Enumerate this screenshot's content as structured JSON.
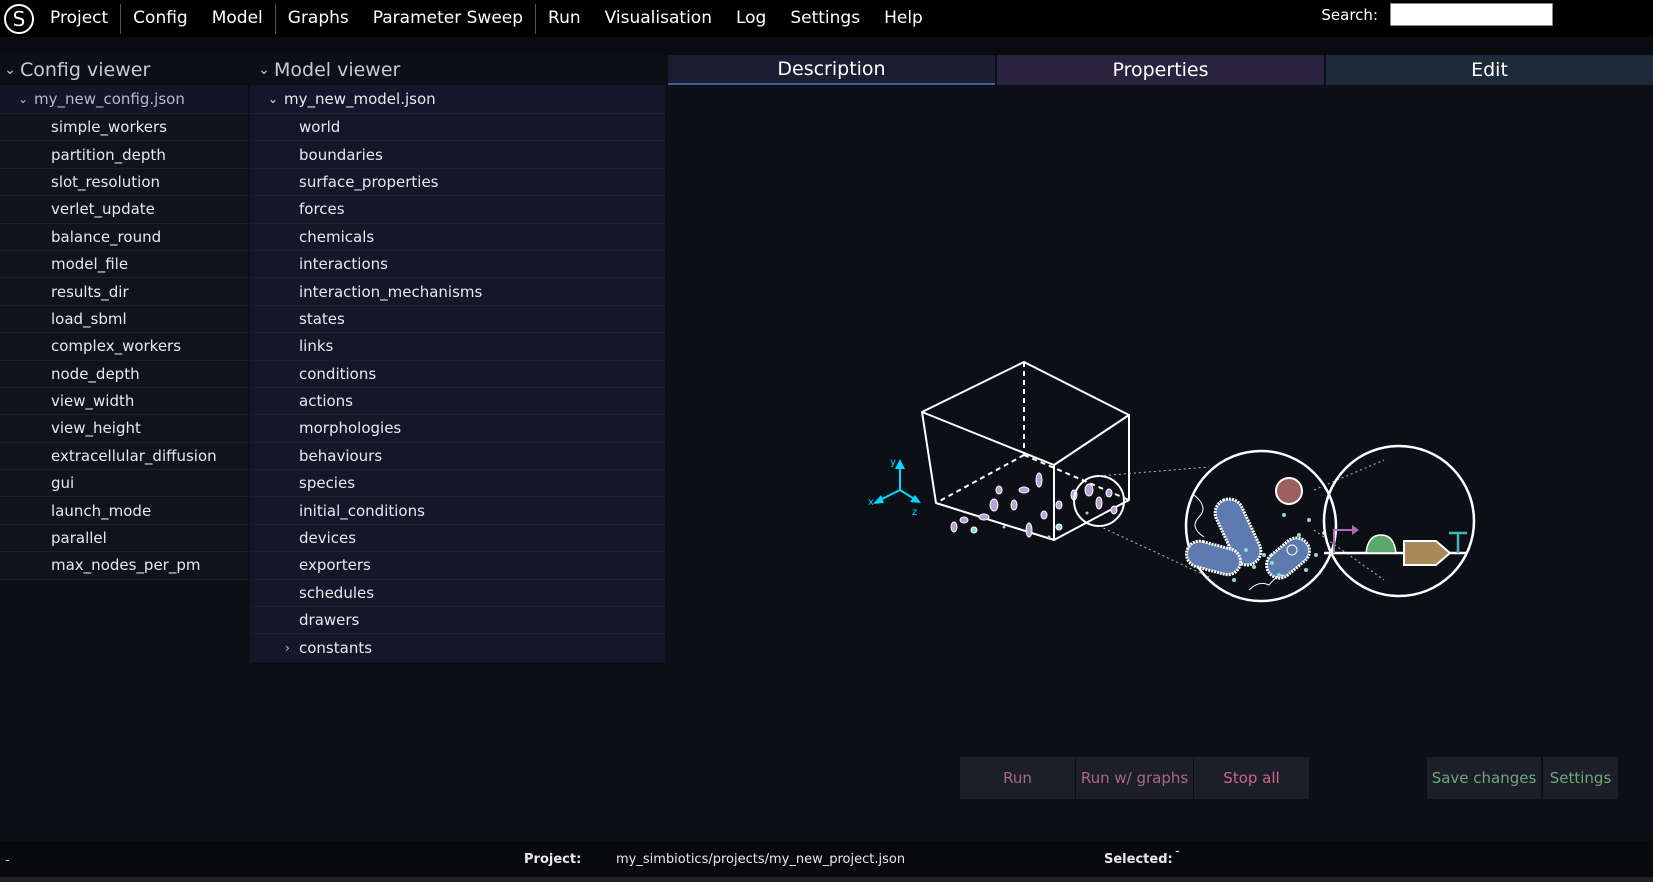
{
  "app": {
    "logo_letter": "S"
  },
  "menu": {
    "items": [
      "Project",
      "Config",
      "Model",
      "Graphs",
      "Parameter Sweep",
      "Run",
      "Visualisation",
      "Log",
      "Settings",
      "Help"
    ]
  },
  "search": {
    "label": "Search:",
    "value": ""
  },
  "config_viewer": {
    "title": "Config viewer",
    "root": "my_new_config.json",
    "items": [
      "simple_workers",
      "partition_depth",
      "slot_resolution",
      "verlet_update",
      "balance_round",
      "model_file",
      "results_dir",
      "load_sbml",
      "complex_workers",
      "node_depth",
      "view_width",
      "view_height",
      "extracellular_diffusion",
      "gui",
      "launch_mode",
      "parallel",
      "max_nodes_per_pm"
    ]
  },
  "model_viewer": {
    "title": "Model viewer",
    "root": "my_new_model.json",
    "items": [
      "world",
      "boundaries",
      "surface_properties",
      "forces",
      "chemicals",
      "interactions",
      "interaction_mechanisms",
      "states",
      "links",
      "conditions",
      "actions",
      "morphologies",
      "behaviours",
      "species",
      "initial_conditions",
      "devices",
      "exporters",
      "schedules",
      "drawers",
      "constants"
    ]
  },
  "tabs": {
    "description": "Description",
    "properties": "Properties",
    "edit": "Edit"
  },
  "buttons": {
    "run": "Run",
    "run_graphs": "Run w/ graphs",
    "stop_all": "Stop all",
    "save_changes": "Save changes",
    "settings": "Settings"
  },
  "axes_labels": {
    "y": "y",
    "x": "x",
    "z": "z"
  },
  "status": {
    "left": "-",
    "project_label": "Project:",
    "project_value": "my_simbiotics/projects/my_new_project.json",
    "selected_label": "Selected:",
    "selected_value": "-"
  },
  "colors": {
    "accent_blue": "#3a5ea8",
    "run_red": "#a86a78",
    "save_green": "#6aa878",
    "cyan_axes": "#00d8ff"
  }
}
